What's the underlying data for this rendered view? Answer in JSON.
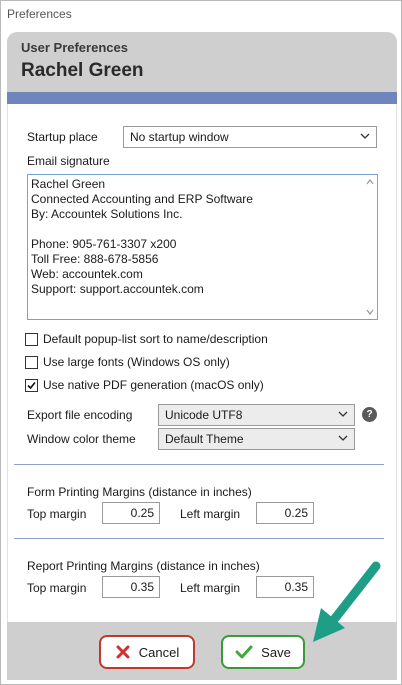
{
  "window": {
    "title": "Preferences"
  },
  "header": {
    "subtitle": "User Preferences",
    "user_name": "Rachel Green"
  },
  "startup": {
    "label": "Startup place",
    "value": "No startup window"
  },
  "email": {
    "label": "Email signature",
    "lines": [
      "Rachel Green",
      "Connected Accounting and ERP Software",
      "By: Accountek Solutions Inc.",
      "",
      "Phone: 905-761-3307 x200",
      "Toll Free: 888-678-5856",
      "Web: accountek.com",
      "Support: support.accountek.com"
    ]
  },
  "options": {
    "popup_sort": {
      "label": "Default popup-list sort to name/description",
      "checked": false
    },
    "large_fonts": {
      "label": "Use large fonts (Windows OS only)",
      "checked": false
    },
    "native_pdf": {
      "label": "Use native PDF generation (macOS only)",
      "checked": true
    }
  },
  "export_encoding": {
    "label": "Export file encoding",
    "value": "Unicode UTF8",
    "help": "?"
  },
  "color_theme": {
    "label": "Window color theme",
    "value": "Default Theme"
  },
  "form_margins": {
    "title": "Form Printing Margins (distance in inches)",
    "top_label": "Top margin",
    "top_value": "0.25",
    "left_label": "Left margin",
    "left_value": "0.25"
  },
  "report_margins": {
    "title": "Report Printing Margins (distance in inches)",
    "top_label": "Top margin",
    "top_value": "0.35",
    "left_label": "Left margin",
    "left_value": "0.35"
  },
  "buttons": {
    "cancel": "Cancel",
    "save": "Save"
  },
  "colors": {
    "accent_bar": "#6f86bd",
    "cancel_border": "#c0392b",
    "save_border": "#3a9a3a",
    "annotation_arrow": "#1e9e86"
  }
}
